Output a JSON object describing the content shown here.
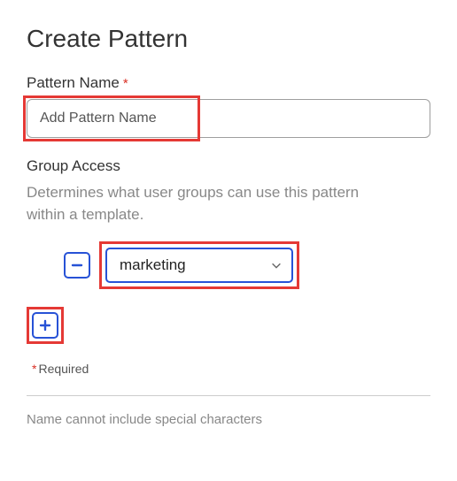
{
  "title": "Create Pattern",
  "patternName": {
    "label": "Pattern Name",
    "requiredMark": "*",
    "placeholder": "Add Pattern Name",
    "value": ""
  },
  "groupAccess": {
    "label": "Group Access",
    "description": "Determines what user groups can use this pattern within a template.",
    "selected": "marketing"
  },
  "requiredNote": {
    "star": "*",
    "text": "Required"
  },
  "footnote": "Name cannot include special characters"
}
